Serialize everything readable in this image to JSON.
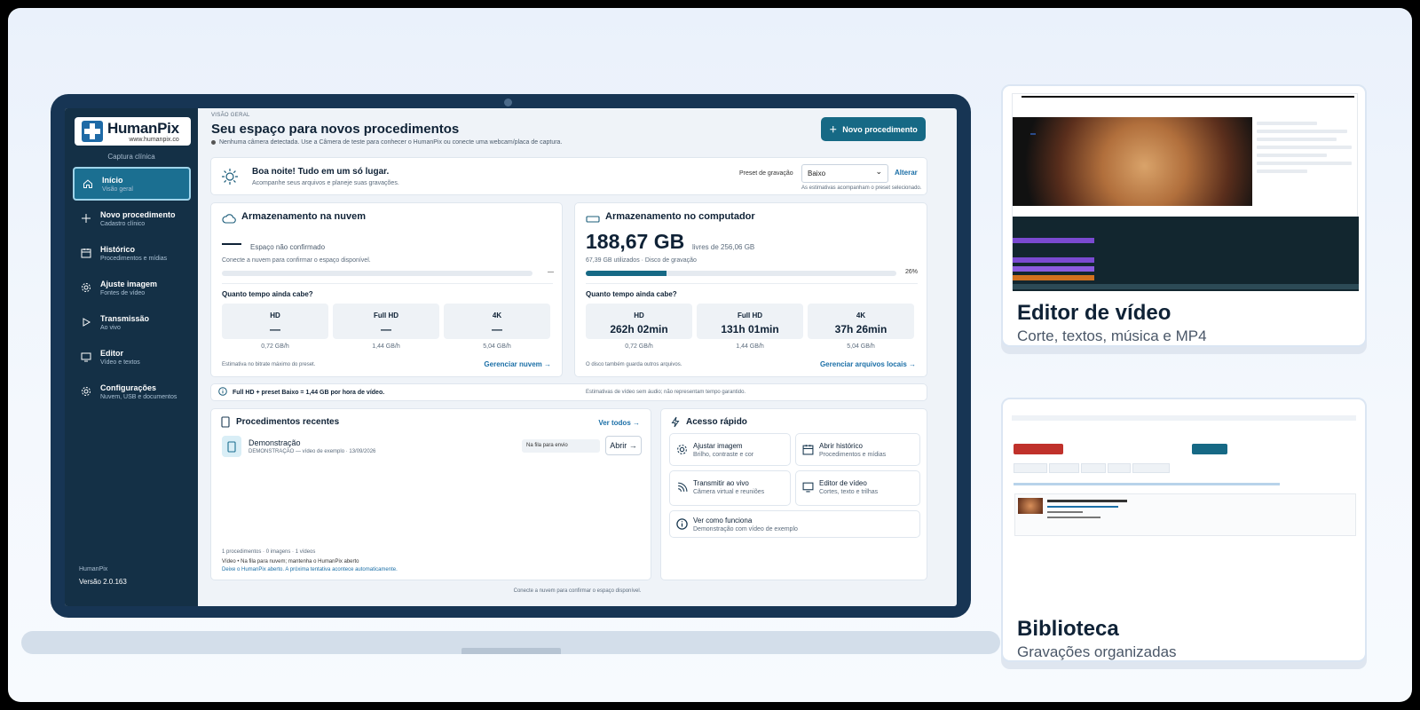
{
  "sidebar": {
    "logo_name": "HumanPix",
    "logo_url": "www.humanpix.co",
    "caption": "Captura clínica",
    "items": [
      {
        "label": "Início",
        "sub": "Visão geral"
      },
      {
        "label": "Novo procedimento",
        "sub": "Cadastro clínico"
      },
      {
        "label": "Histórico",
        "sub": "Procedimentos e mídias"
      },
      {
        "label": "Ajuste imagem",
        "sub": "Fontes de vídeo"
      },
      {
        "label": "Transmissão",
        "sub": "Ao vivo"
      },
      {
        "label": "Editor",
        "sub": "Vídeo e textos"
      },
      {
        "label": "Configurações",
        "sub": "Nuvem, USB e documentos"
      }
    ],
    "footer_name": "HumanPix",
    "version": "Versão 2.0.163"
  },
  "header": {
    "eyebrow": "VISÃO GERAL",
    "title": "Seu espaço para novos procedimentos",
    "notice": "Nenhuma câmera detectada. Use a Câmera de teste para conhecer o HumanPix ou conecte uma webcam/placa de captura.",
    "new_button": "Novo procedimento"
  },
  "greeting": {
    "title": "Boa noite! Tudo em um só lugar.",
    "subtitle": "Acompanhe seus arquivos e planeje suas gravações.",
    "preset_label": "Preset de gravação",
    "preset_value": "Baixo",
    "change_link": "Alterar",
    "preset_note": "As estimativas acompanham o preset selecionado."
  },
  "cloud": {
    "title": "Armazenamento na nuvem",
    "status": "Espaço não confirmado",
    "hint": "Conecte a nuvem para confirmar o espaço disponível.",
    "bar_label": "—",
    "question": "Quanto tempo ainda cabe?",
    "tiles": [
      {
        "label": "HD",
        "value": "—",
        "rate": "0,72 GB/h"
      },
      {
        "label": "Full HD",
        "value": "—",
        "rate": "1,44 GB/h"
      },
      {
        "label": "4K",
        "value": "—",
        "rate": "5,04 GB/h"
      }
    ],
    "footnote": "Estimativa no bitrate máximo do preset.",
    "link": "Gerenciar nuvem →"
  },
  "local": {
    "title": "Armazenamento no computador",
    "free": "188,67 GB",
    "free_sub": "livres de 256,06 GB",
    "used": "67,39 GB utilizados · Disco de gravação",
    "usage_percent": 26,
    "usage_label": "26%",
    "question": "Quanto tempo ainda cabe?",
    "tiles": [
      {
        "label": "HD",
        "value": "262h 02min",
        "rate": "0,72 GB/h"
      },
      {
        "label": "Full HD",
        "value": "131h 01min",
        "rate": "1,44 GB/h"
      },
      {
        "label": "4K",
        "value": "37h 26min",
        "rate": "5,04 GB/h"
      }
    ],
    "footnote": "O disco também guarda outros arquivos.",
    "link": "Gerenciar arquivos locais →"
  },
  "info_bar": {
    "text": "Full HD + preset Baixo = 1,44 GB por hora de vídeo.",
    "note": "Estimativas de vídeo sem áudio; não representam tempo garantido."
  },
  "recent": {
    "title": "Procedimentos recentes",
    "see_all": "Ver todos →",
    "items": [
      {
        "name": "Demonstração",
        "sub": "DEMONSTRAÇÃO — vídeo de exemplo · 13/09/2026",
        "status": "Na fila para envio",
        "open": "Abrir →"
      }
    ],
    "stats": "1 procedimentos · 0 imagens · 1 vídeos",
    "queue_note": "Vídeo • Na fila para nuvem; mantenha o HumanPix aberto",
    "keep_note": "Deixe o HumanPix aberto. A próxima tentativa acontece automaticamente."
  },
  "quick": {
    "title": "Acesso rápido",
    "items": [
      {
        "title": "Ajustar imagem",
        "sub": "Brilho, contraste e cor",
        "icon": "gear-icon"
      },
      {
        "title": "Abrir histórico",
        "sub": "Procedimentos e mídias",
        "icon": "calendar-icon"
      },
      {
        "title": "Transmitir ao vivo",
        "sub": "Câmera virtual e reuniões",
        "icon": "broadcast-icon"
      },
      {
        "title": "Editor de vídeo",
        "sub": "Cortes, texto e trilhas",
        "icon": "monitor-icon"
      },
      {
        "title": "Ver como funciona",
        "sub": "Demonstração com vídeo de exemplo",
        "icon": "info-icon"
      }
    ]
  },
  "screen_footer": "Conecte a nuvem para confirmar o espaço disponível.",
  "promos": [
    {
      "title": "Editor de vídeo",
      "subtitle": "Corte, textos, música e MP4"
    },
    {
      "title": "Biblioteca",
      "subtitle": "Gravações organizadas"
    }
  ],
  "colors": {
    "accent": "#166985",
    "sidebar": "#143046",
    "bezel": "#173554",
    "link": "#1b6fa7"
  }
}
